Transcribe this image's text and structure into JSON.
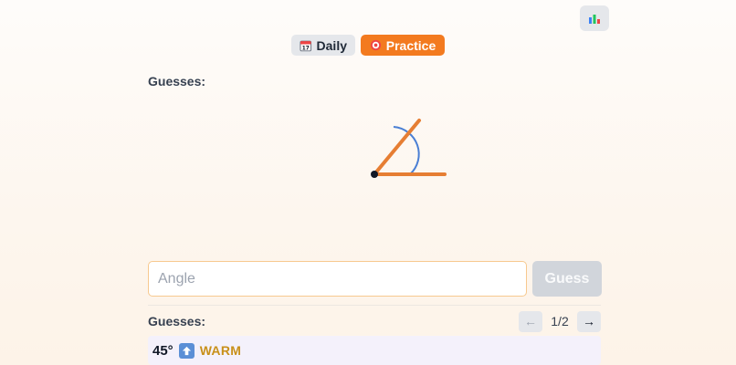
{
  "header": {
    "stats_icon": "bar-chart-icon"
  },
  "modes": {
    "daily": {
      "label": "Daily",
      "icon": "calendar-icon"
    },
    "practice": {
      "label": "Practice",
      "icon": "target-icon",
      "active": true
    }
  },
  "puzzle": {
    "guesses_label": "Guesses:",
    "angle_display": {
      "line_color": "#e67e33",
      "arc_color": "#4a7fd4",
      "vertex_color": "#111827"
    }
  },
  "input": {
    "placeholder": "Angle",
    "value": "",
    "guess_label": "Guess"
  },
  "history": {
    "guesses_label": "Guesses:",
    "page_text": "1/2",
    "prev_label": "←",
    "next_label": "→",
    "rows": [
      {
        "value": "45°",
        "direction_icon": "up-arrow-icon",
        "status": "WARM",
        "status_color": "#c8901a"
      }
    ]
  },
  "colors": {
    "accent": "#f37a1f",
    "input_border": "#f7c98f"
  }
}
